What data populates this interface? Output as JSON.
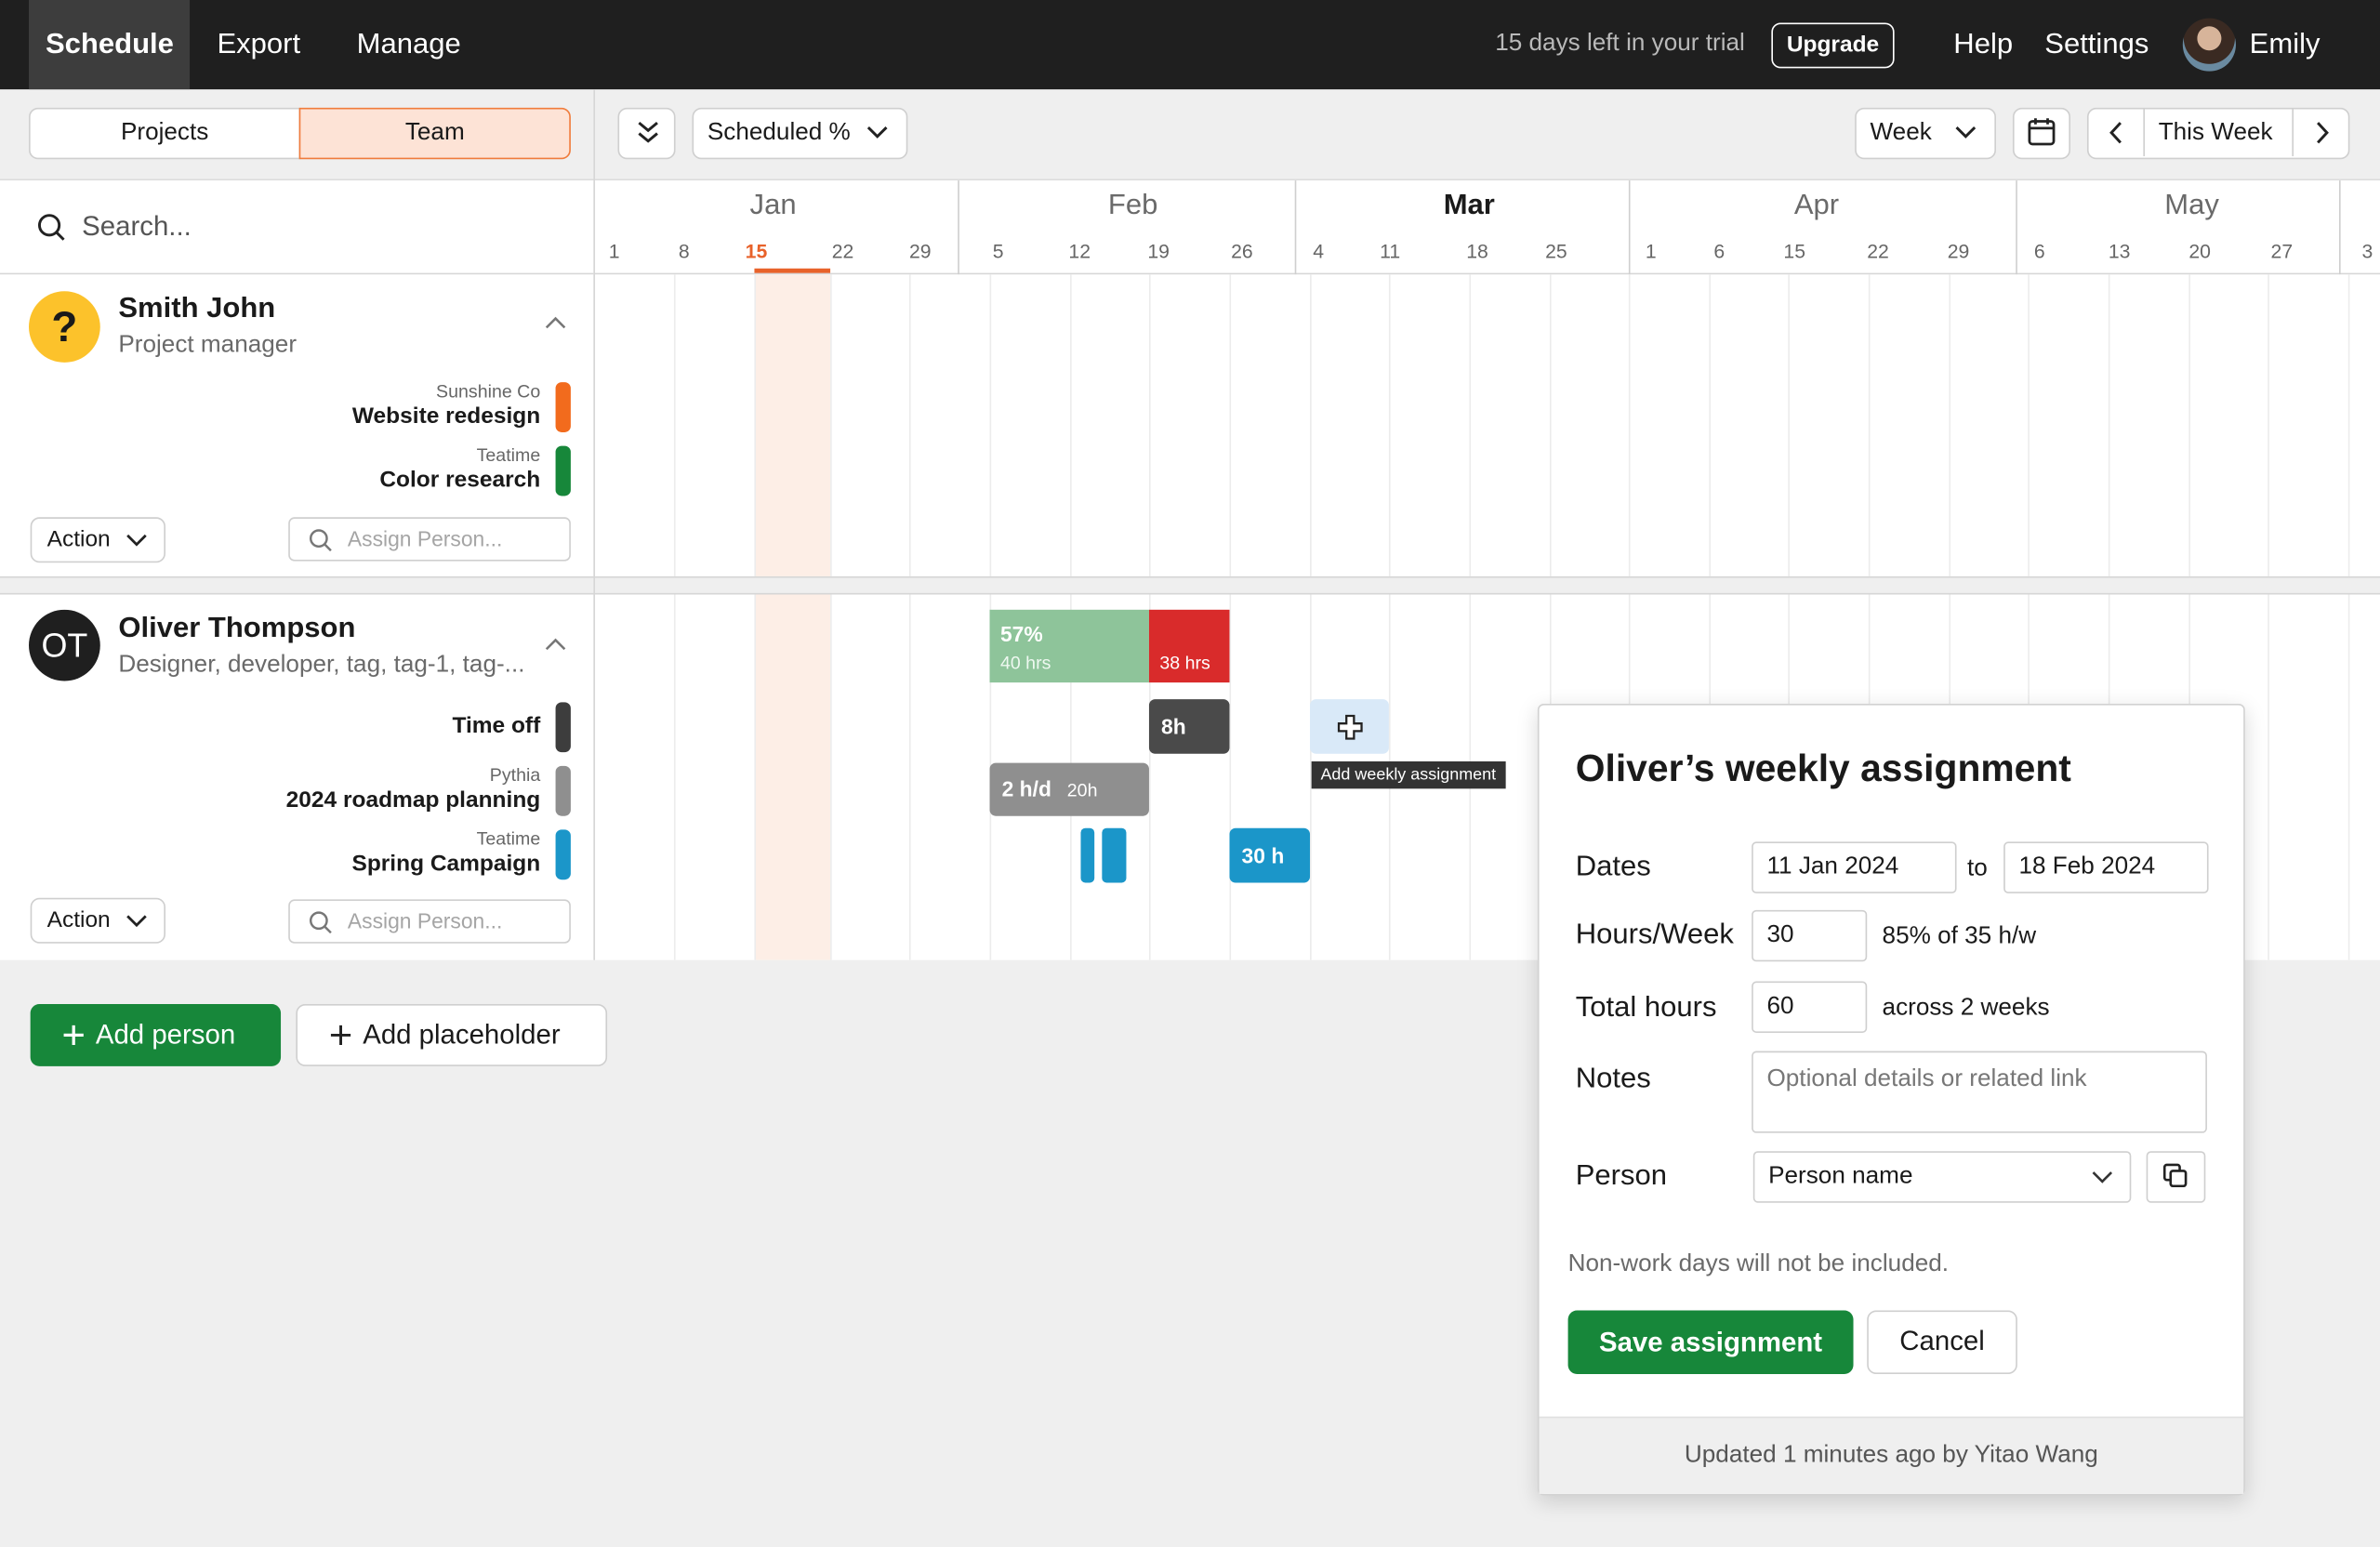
{
  "nav": {
    "tabs": [
      {
        "label": "Schedule"
      },
      {
        "label": "Export"
      },
      {
        "label": "Manage"
      }
    ],
    "trial_text": "15 days left in your trial",
    "upgrade_label": "Upgrade",
    "help_label": "Help",
    "settings_label": "Settings",
    "user_name": "Emily"
  },
  "toolbar": {
    "view_projects": "Projects",
    "view_team": "Team",
    "metric_select": "Scheduled %",
    "period_select": "Week",
    "this_week_label": "This Week"
  },
  "search": {
    "placeholder": "Search..."
  },
  "timeline": {
    "months": [
      "Jan",
      "Feb",
      "Mar",
      "Apr",
      "May"
    ],
    "current_month": "Mar",
    "days": [
      "1",
      "8",
      "15",
      "22",
      "29",
      "5",
      "12",
      "19",
      "26",
      "4",
      "11",
      "18",
      "25",
      "1",
      "6",
      "15",
      "22",
      "29",
      "6",
      "13",
      "20",
      "27",
      "3"
    ],
    "today_day": "15"
  },
  "people": [
    {
      "avatar_text": "?",
      "name": "Smith John",
      "role": "Project manager",
      "projects": [
        {
          "client": "Sunshine Co",
          "name": "Website redesign",
          "color": "#f26b1d"
        },
        {
          "client": "Teatime",
          "name": "Color research",
          "color": "#17873a"
        }
      ],
      "action_label": "Action",
      "assign_placeholder": "Assign Person..."
    },
    {
      "avatar_text": "OT",
      "name": "Oliver Thompson",
      "role": "Designer, developer, tag, tag-1, tag-...",
      "projects": [
        {
          "client": "",
          "name": "Time off",
          "color": "#3d3d3d"
        },
        {
          "client": "Pythia",
          "name": "2024 roadmap planning",
          "color": "#8f8f8f"
        },
        {
          "client": "Teatime",
          "name": "Spring Campaign",
          "color": "#1b96c9"
        }
      ],
      "action_label": "Action",
      "assign_placeholder": "Assign Person..."
    }
  ],
  "bars": {
    "util_pct": "57%",
    "util_hrs": "40 hrs",
    "over_hrs": "38 hrs",
    "timeoff": "8h",
    "roadmap_rate": "2 h/d",
    "roadmap_total": "20h",
    "campaign": "30 h",
    "add_tooltip": "Add weekly assignment"
  },
  "buttons": {
    "add_person": "Add person",
    "add_placeholder": "Add placeholder"
  },
  "assignment": {
    "title": "Oliver’s weekly assignment",
    "dates_label": "Dates",
    "start_date": "11 Jan 2024",
    "to_label": "to",
    "end_date": "18 Feb 2024",
    "hours_label": "Hours/Week",
    "hours_value": "30",
    "hours_note": "85% of 35 h/w",
    "total_label": "Total hours",
    "total_value": "60",
    "total_note": "across 2 weeks",
    "notes_label": "Notes",
    "notes_placeholder": "Optional details or related link",
    "person_label": "Person",
    "person_value": "Person name",
    "nonwork_note": "Non-work days will not be included.",
    "save_label": "Save assignment",
    "cancel_label": "Cancel",
    "updated_text": "Updated 1 minutes ago by Yitao Wang"
  },
  "colors": {
    "brand_green": "#17873a",
    "accent_orange": "#f07c3c",
    "over_red": "#d92b2b",
    "util_green": "#8ec49a",
    "campaign_blue": "#1b96c9"
  }
}
